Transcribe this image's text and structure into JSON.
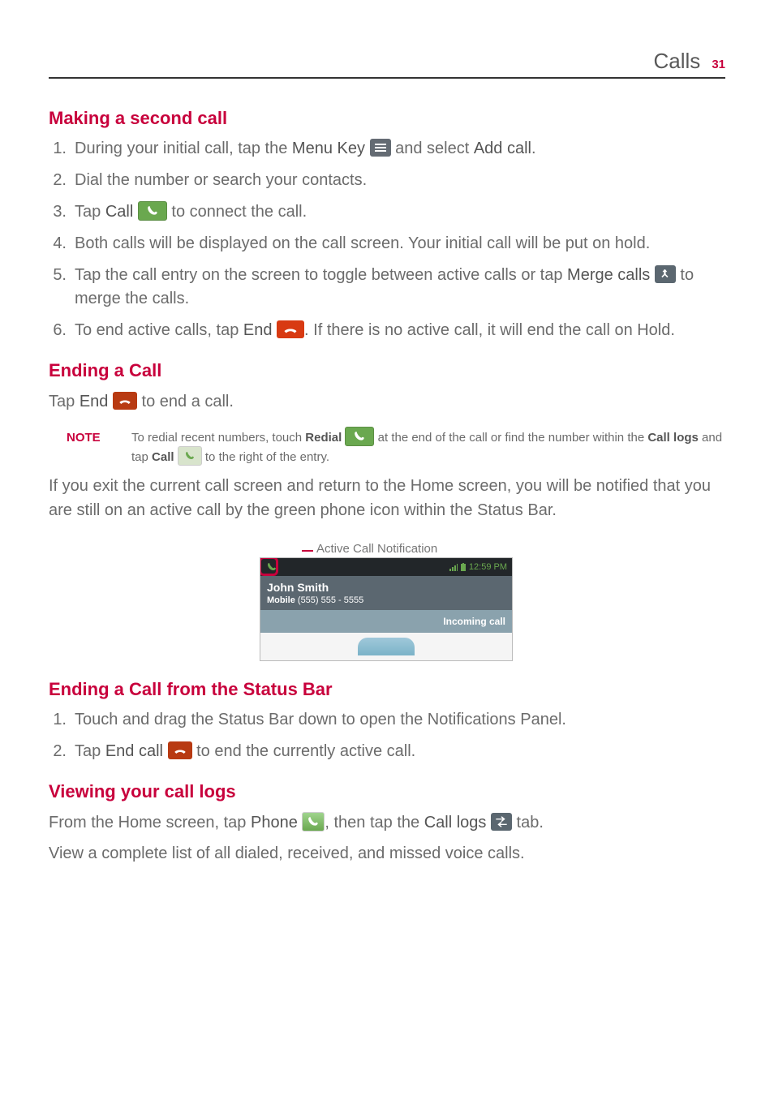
{
  "header": {
    "section": "Calls",
    "page_number": "31"
  },
  "sections": {
    "second_call": {
      "heading": "Making a second call",
      "steps": {
        "s1_a": "During your initial call, tap the ",
        "s1_b": "Menu Key ",
        "s1_c": " and select ",
        "s1_d": "Add call",
        "s1_e": ".",
        "s2": "Dial the number or search your contacts.",
        "s3_a": "Tap ",
        "s3_b": "Call ",
        "s3_c": " to connect the call.",
        "s4": "Both calls will be displayed on the call screen. Your initial call will be put on hold.",
        "s5_a": "Tap the call entry on the screen to toggle between active calls or tap ",
        "s5_b": "Merge calls ",
        "s5_c": " to merge the calls.",
        "s6_a": "To end active calls, tap ",
        "s6_b": "End ",
        "s6_c": ". If there is no active call, it will end the call on Hold."
      }
    },
    "ending": {
      "heading": "Ending a Call",
      "line_a": "Tap ",
      "line_b": "End ",
      "line_c": " to end a call.",
      "note_label": "NOTE",
      "note": {
        "a": "To redial recent numbers, touch ",
        "b": "Redial ",
        "c": " at the end of the call or find the number within the ",
        "d": "Call logs",
        "e": " and tap ",
        "f": "Call ",
        "g": " to the right of the entry."
      },
      "para": "If you exit the current call screen and return to the Home screen, you will be notified that you are still on an active call by the green phone icon within the Status Bar.",
      "fig_label": "Active Call Notification",
      "fig": {
        "time": "12:59 PM",
        "name": "John Smith",
        "type": "Mobile",
        "number": "(555) 555 - 5555",
        "incoming": "Incoming call"
      }
    },
    "status_bar": {
      "heading": "Ending a Call from the Status Bar",
      "s1": "Touch and drag the Status Bar down to open the Notifications Panel.",
      "s2_a": "Tap ",
      "s2_b": "End call ",
      "s2_c": " to end the currently active call."
    },
    "call_logs": {
      "heading": "Viewing your call logs",
      "p1_a": "From the Home screen, tap ",
      "p1_b": "Phone ",
      "p1_c": ", then tap the ",
      "p1_d": "Call logs ",
      "p1_e": " tab.",
      "p2": "View a complete list of all dialed, received, and missed voice calls."
    }
  }
}
